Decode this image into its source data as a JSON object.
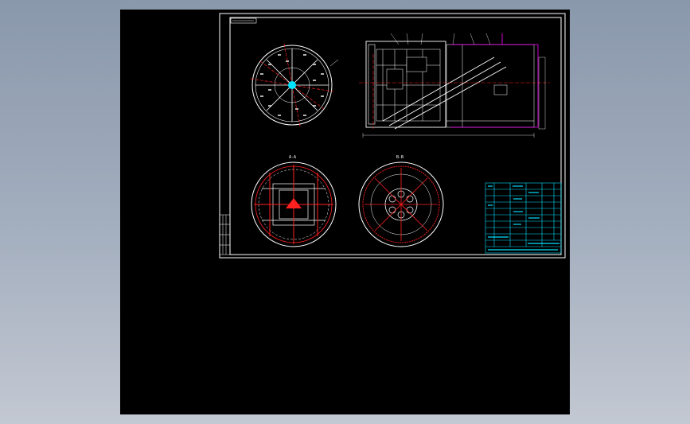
{
  "drawing": {
    "title_block_header": "",
    "views": {
      "cutterhead_front": {
        "name": "cutterhead-front-view"
      },
      "section_a": {
        "label": "A-A"
      },
      "section_b": {
        "label": "B-B"
      },
      "side_view": {
        "name": "tbm-side-view"
      }
    }
  },
  "colors": {
    "background": "#000000",
    "frame": "#ffffff",
    "centerline": "#ff2020",
    "titleblock": "#00e0ff",
    "accent": "#ff00ff",
    "hub": "#00e5ff"
  }
}
